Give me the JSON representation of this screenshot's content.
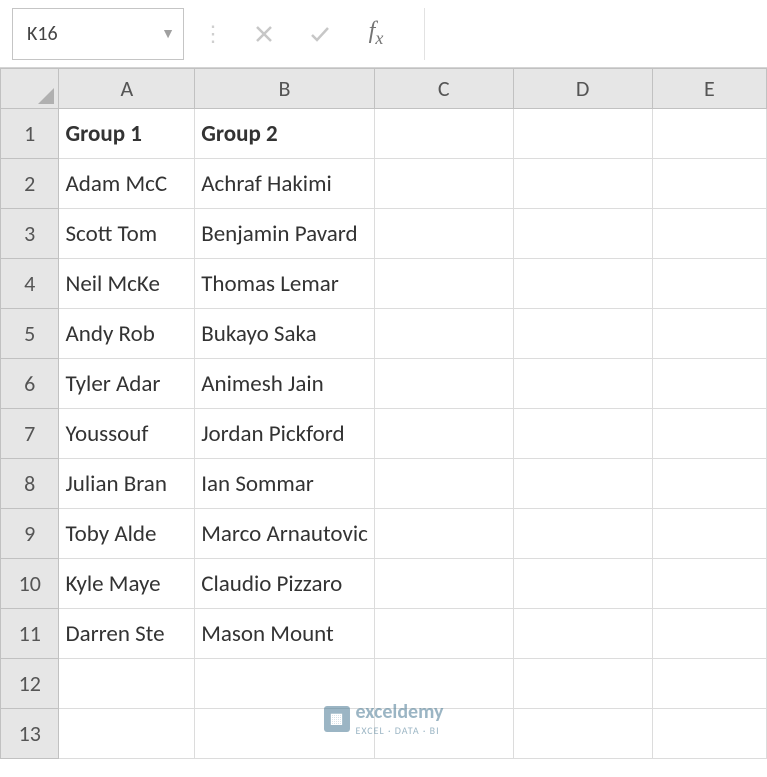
{
  "nameBox": {
    "value": "K16"
  },
  "formulaBar": {
    "value": ""
  },
  "columns": [
    "A",
    "B",
    "C",
    "D",
    "E"
  ],
  "rows": [
    "1",
    "2",
    "3",
    "4",
    "5",
    "6",
    "7",
    "8",
    "9",
    "10",
    "11",
    "12",
    "13"
  ],
  "data": {
    "A": [
      "Group 1",
      "Adam McGill",
      "Scott Tominay",
      "Neil McKenna",
      "Andy Robertson",
      "Tyler Adams",
      "Youssouf Fofana",
      "Julian Brandt",
      "Toby Alderweireld",
      "Kyle Mayers",
      "Darren Stevens",
      "",
      ""
    ],
    "B": [
      "Group 2",
      "Achraf Hakimi",
      "Benjamin Pavard",
      "Thomas Lemar",
      "Bukayo Saka",
      "Animesh Jain",
      "Jordan Pickford",
      "Ian Sommar",
      "Marco Arnautovic",
      "Claudio Pizzaro",
      "Mason Mount",
      "",
      ""
    ],
    "A_display": [
      "Group 1",
      "Adam McC",
      "Scott Tom",
      "Neil McKe",
      "Andy Rob",
      "Tyler Adar",
      "Youssouf",
      "Julian Bran",
      "Toby Alde",
      "Kyle Maye",
      "Darren Ste",
      "",
      ""
    ]
  },
  "chart_data": {
    "type": "table",
    "columns": [
      "Group 1",
      "Group 2"
    ],
    "rows": [
      [
        "Adam McGill",
        "Achraf Hakimi"
      ],
      [
        "Scott Tominay",
        "Benjamin Pavard"
      ],
      [
        "Neil McKenna",
        "Thomas Lemar"
      ],
      [
        "Andy Robertson",
        "Bukayo Saka"
      ],
      [
        "Tyler Adams",
        "Animesh Jain"
      ],
      [
        "Youssouf Fofana",
        "Jordan Pickford"
      ],
      [
        "Julian Brandt",
        "Ian Sommar"
      ],
      [
        "Toby Alderweireld",
        "Marco Arnautovic"
      ],
      [
        "Kyle Mayers",
        "Claudio Pizzaro"
      ],
      [
        "Darren Stevens",
        "Mason Mount"
      ]
    ]
  },
  "watermark": {
    "name": "exceldemy",
    "tag": "EXCEL · DATA · BI"
  }
}
